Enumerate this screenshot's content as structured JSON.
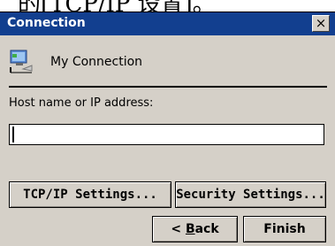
{
  "top_fragment": "的[TCP/IP 设置]。",
  "window": {
    "title": "Connection",
    "close_symbol": "×"
  },
  "connection": {
    "icon": "network-connection-icon",
    "name": "My Connection"
  },
  "host": {
    "label": "Host name or IP address:",
    "value": ""
  },
  "buttons": {
    "tcpip": "TCP/IP Settings...",
    "security": "Security Settings...",
    "back_prefix": "< ",
    "back_accel": "B",
    "back_rest": "ack",
    "finish": "Finish"
  },
  "colors": {
    "titlebar": "#123f8f",
    "dialog_bg": "#d5d0c8"
  }
}
